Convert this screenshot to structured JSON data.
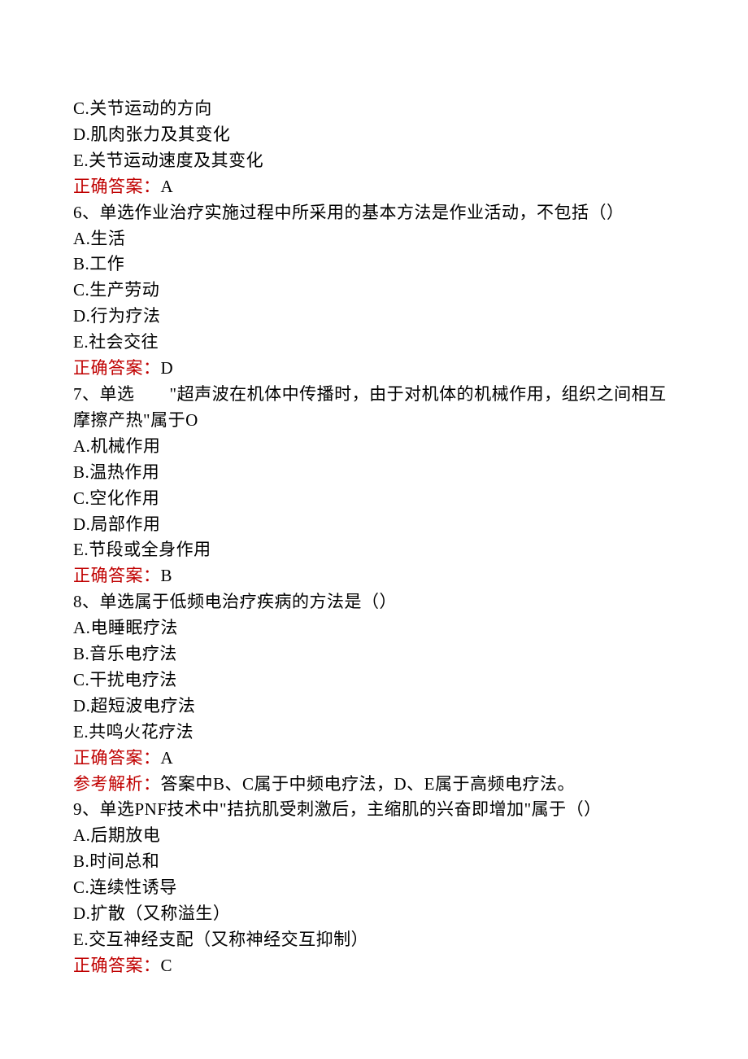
{
  "lines": {
    "q5_optC": "C.关节运动的方向",
    "q5_optD": "D.肌肉张力及其变化",
    "q5_optE": "E.关节运动速度及其变化",
    "answerLabel": "正确答案：",
    "q5_answer": "A",
    "q6_stem": "6、单选作业治疗实施过程中所采用的基本方法是作业活动，不包括（）",
    "q6_optA": "A.生活",
    "q6_optB": "B.工作",
    "q6_optC": "C.生产劳动",
    "q6_optD": "D.行为疗法",
    "q6_optE": "E.社会交往",
    "q6_answer": "D",
    "q7_stem": "7、单选　　\"超声波在机体中传播时，由于对机体的机械作用，组织之间相互摩擦产热\"属于O",
    "q7_optA": "A.机械作用",
    "q7_optB": "B.温热作用",
    "q7_optC": "C.空化作用",
    "q7_optD": "D.局部作用",
    "q7_optE": "E.节段或全身作用",
    "q7_answer": "B",
    "q8_stem": "8、单选属于低频电治疗疾病的方法是（）",
    "q8_optA": "A.电睡眠疗法",
    "q8_optB": "B.音乐电疗法",
    "q8_optC": "C.干扰电疗法",
    "q8_optD": "D.超短波电疗法",
    "q8_optE": "E.共鸣火花疗法",
    "q8_answer": "A",
    "analysisLabel": "参考解析：",
    "q8_analysis": "答案中B、C属于中频电疗法，D、E属于高频电疗法。",
    "q9_stem": "9、单选PNF技术中\"拮抗肌受刺激后，主缩肌的兴奋即增加\"属于（）",
    "q9_optA": "A.后期放电",
    "q9_optB": "B.时间总和",
    "q9_optC": "C.连续性诱导",
    "q9_optD": "D.扩散（又称溢生）",
    "q9_optE": "E.交互神经支配（又称神经交互抑制）",
    "q9_answer": "C"
  }
}
